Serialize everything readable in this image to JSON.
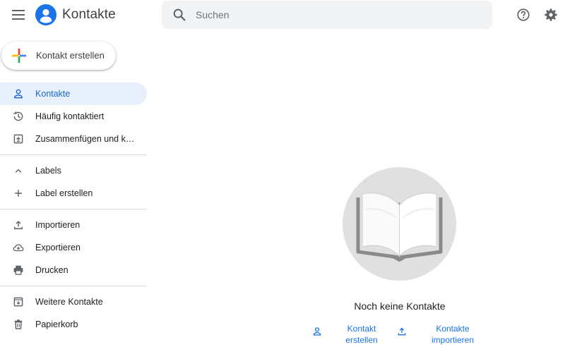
{
  "header": {
    "app_title": "Kontakte",
    "search_placeholder": "Suchen"
  },
  "create_button": {
    "label": "Kontakt erstellen"
  },
  "sidebar": {
    "items": [
      {
        "label": "Kontakte",
        "icon": "person-icon",
        "active": true
      },
      {
        "label": "Häufig kontaktiert",
        "icon": "history-icon"
      },
      {
        "label": "Zusammenfügen und k…",
        "icon": "merge-icon"
      },
      {
        "label": "Labels",
        "icon": "chevron-up-icon"
      },
      {
        "label": "Label erstellen",
        "icon": "plus-icon"
      },
      {
        "label": "Importieren",
        "icon": "upload-icon"
      },
      {
        "label": "Exportieren",
        "icon": "cloud-download-icon"
      },
      {
        "label": "Drucken",
        "icon": "printer-icon"
      },
      {
        "label": "Weitere Kontakte",
        "icon": "archive-icon"
      },
      {
        "label": "Papierkorb",
        "icon": "trash-icon"
      }
    ]
  },
  "empty_state": {
    "message": "Noch keine Kontakte",
    "create_line1": "Kontakt",
    "create_line2": "erstellen",
    "import_line1": "Kontakte",
    "import_line2": "importieren"
  },
  "colors": {
    "accent": "#1a73e8",
    "active_bg": "#e8f0fe",
    "icon_gray": "#5f6368",
    "search_bg": "#f1f3f4"
  }
}
